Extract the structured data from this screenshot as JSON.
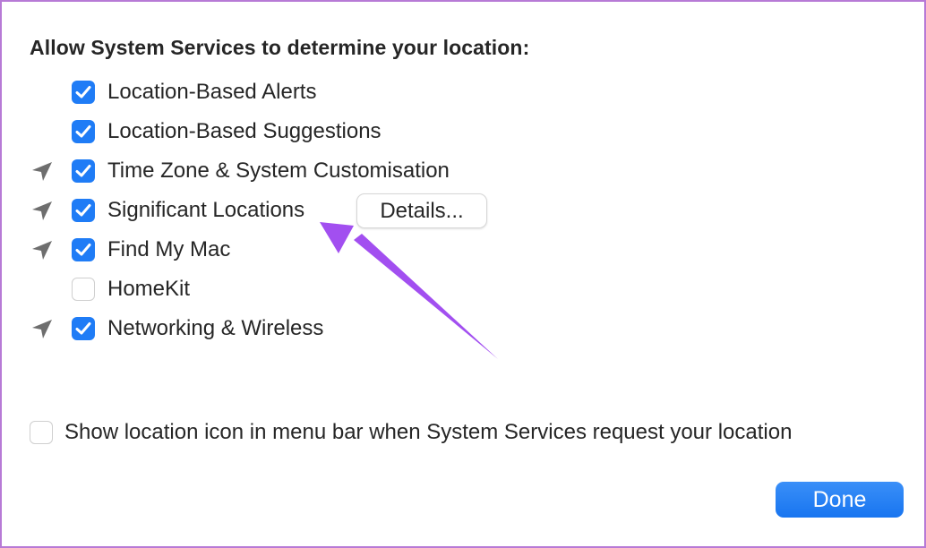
{
  "dialog": {
    "heading": "Allow System Services to determine your location:",
    "services": [
      {
        "label": "Location-Based Alerts",
        "checked": true,
        "location_icon": false
      },
      {
        "label": "Location-Based Suggestions",
        "checked": true,
        "location_icon": false
      },
      {
        "label": "Time Zone & System Customisation",
        "checked": true,
        "location_icon": true
      },
      {
        "label": "Significant Locations",
        "checked": true,
        "location_icon": true
      },
      {
        "label": "Find My Mac",
        "checked": true,
        "location_icon": true
      },
      {
        "label": "HomeKit",
        "checked": false,
        "location_icon": false
      },
      {
        "label": "Networking & Wireless",
        "checked": true,
        "location_icon": true
      }
    ],
    "details_button": "Details...",
    "show_icon_option": {
      "label": "Show location icon in menu bar when System Services request your location",
      "checked": false
    },
    "done_button": "Done"
  },
  "colors": {
    "accent": "#1f7cf6",
    "annotation_arrow": "#a24ff0",
    "frame_border": "#b77ad6"
  }
}
